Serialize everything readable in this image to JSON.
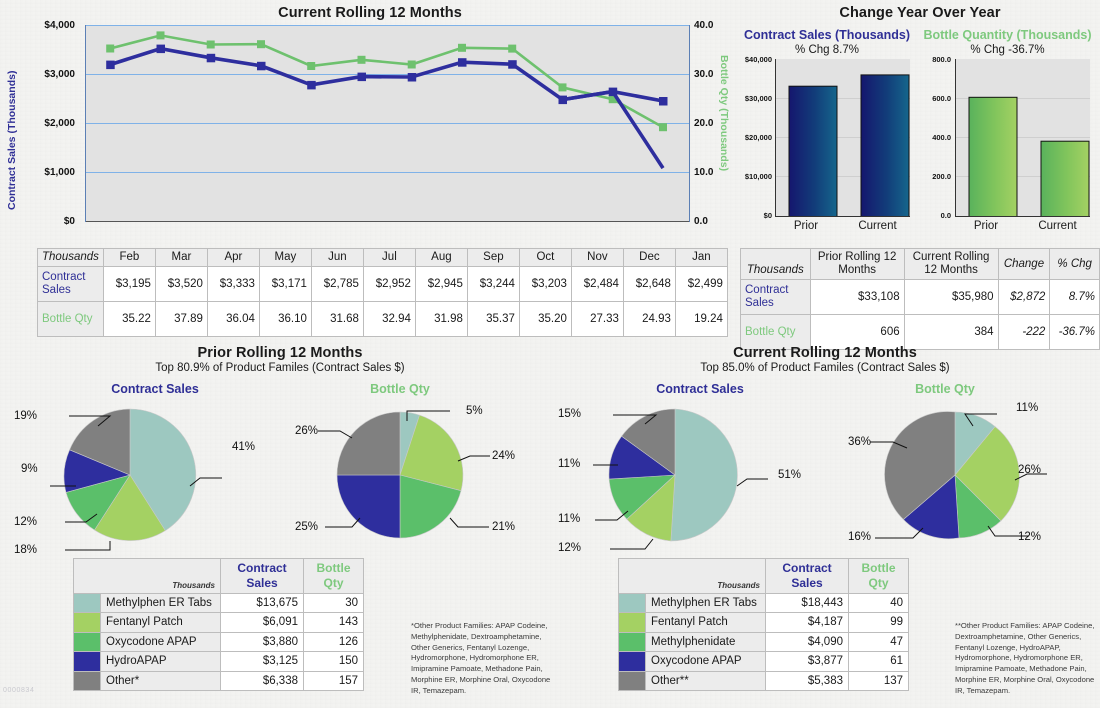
{
  "watermark": "0000834",
  "line_chart": {
    "title": "Current Rolling 12 Months",
    "y_left_label": "Contract Sales (Thousands)",
    "y_right_label": "Bottle Qty (Thousands)",
    "y_left_ticks": [
      "$4,000",
      "$3,000",
      "$2,000",
      "$1,000",
      "$0"
    ],
    "y_right_ticks": [
      "40.0",
      "30.0",
      "20.0",
      "10.0",
      "0.0"
    ]
  },
  "monthly_table": {
    "corner": "Thousands",
    "months": [
      "Feb",
      "Mar",
      "Apr",
      "May",
      "Jun",
      "Jul",
      "Aug",
      "Sep",
      "Oct",
      "Nov",
      "Dec",
      "Jan"
    ],
    "rows": [
      {
        "label": "Contract Sales",
        "values": [
          "$3,195",
          "$3,520",
          "$3,333",
          "$3,171",
          "$2,785",
          "$2,952",
          "$2,945",
          "$3,244",
          "$3,203",
          "$2,484",
          "$2,648",
          "$2,499"
        ]
      },
      {
        "label": "Bottle Qty",
        "values": [
          "35.22",
          "37.89",
          "36.04",
          "36.10",
          "31.68",
          "32.94",
          "31.98",
          "35.37",
          "35.20",
          "27.33",
          "24.93",
          "19.24"
        ]
      }
    ]
  },
  "yoy": {
    "title": "Change Year Over Year",
    "left": {
      "title": "Contract Sales (Thousands)",
      "pct_chg": "% Chg 8.7%",
      "y_ticks": [
        "$40,000",
        "$30,000",
        "$20,000",
        "$10,000",
        "$0"
      ],
      "categories": [
        "Prior",
        "Current"
      ]
    },
    "right": {
      "title": "Bottle Quantity (Thousands)",
      "pct_chg": "% Chg -36.7%",
      "y_ticks": [
        "800.0",
        "600.0",
        "400.0",
        "200.0",
        "0.0"
      ],
      "categories": [
        "Prior",
        "Current"
      ]
    }
  },
  "yoy_table": {
    "corner": "Thousands",
    "headers": [
      "Prior Rolling 12 Months",
      "Current Rolling 12 Months",
      "Change",
      "% Chg"
    ],
    "rows": [
      {
        "label": "Contract Sales",
        "prior": "$33,108",
        "current": "$35,980",
        "change": "$2,872",
        "pct": "8.7%"
      },
      {
        "label": "Bottle Qty",
        "prior": "606",
        "current": "384",
        "change": "-222",
        "pct": "-36.7%"
      }
    ]
  },
  "prior_panel": {
    "title": "Prior Rolling 12 Months",
    "subtitle": "Top 80.9% of Product Familes (Contract Sales $)",
    "pie_left_title": "Contract Sales",
    "pie_right_title": "Bottle Qty",
    "table": {
      "corner": "Thousands",
      "col_sales": "Contract Sales",
      "col_qty": "Bottle Qty",
      "rows": [
        {
          "name": "Methylphen ER Tabs",
          "sales": "$13,675",
          "qty": "30",
          "color": "#9dc8c0"
        },
        {
          "name": "Fentanyl Patch",
          "sales": "$6,091",
          "qty": "143",
          "color": "#a4d163"
        },
        {
          "name": "Oxycodone APAP",
          "sales": "$3,880",
          "qty": "126",
          "color": "#5bbf6a"
        },
        {
          "name": "HydroAPAP",
          "sales": "$3,125",
          "qty": "150",
          "color": "#2e2e9e"
        },
        {
          "name": "Other*",
          "sales": "$6,338",
          "qty": "157",
          "color": "#808080"
        }
      ]
    },
    "footnote": "*Other Product Families: APAP Codeine, Methylphenidate, Dextroamphetamine, Other Generics, Fentanyl Lozenge, Hydromorphone, Hydromorphone ER, Imipramine Pamoate, Methadone Pain, Morphine ER, Morphine Oral, Oxycodone IR, Temazepam."
  },
  "current_panel": {
    "title": "Current Rolling 12 Months",
    "subtitle": "Top 85.0% of Product Familes (Contract Sales $)",
    "pie_left_title": "Contract Sales",
    "pie_right_title": "Bottle Qty",
    "table": {
      "corner": "Thousands",
      "col_sales": "Contract Sales",
      "col_qty": "Bottle Qty",
      "rows": [
        {
          "name": "Methylphen ER Tabs",
          "sales": "$18,443",
          "qty": "40",
          "color": "#9dc8c0"
        },
        {
          "name": "Fentanyl Patch",
          "sales": "$4,187",
          "qty": "99",
          "color": "#a4d163"
        },
        {
          "name": "Methylphenidate",
          "sales": "$4,090",
          "qty": "47",
          "color": "#5bbf6a"
        },
        {
          "name": "Oxycodone APAP",
          "sales": "$3,877",
          "qty": "61",
          "color": "#2e2e9e"
        },
        {
          "name": "Other**",
          "sales": "$5,383",
          "qty": "137",
          "color": "#808080"
        }
      ]
    },
    "footnote": "**Other Product Families: APAP Codeine, Dextroamphetamine, Other Generics, Fentanyl Lozenge, HydroAPAP, Hydromorphone, Hydromorphone ER, Imipramine Pamoate, Methadone Pain, Morphine ER, Morphine Oral, Oxycodone IR, Temazepam."
  },
  "chart_data": [
    {
      "type": "line",
      "title": "Current Rolling 12 Months",
      "xlabel": "",
      "ylabel": "Contract Sales (Thousands)",
      "y2label": "Bottle Qty (Thousands)",
      "categories": [
        "Feb",
        "Mar",
        "Apr",
        "May",
        "Jun",
        "Jul",
        "Aug",
        "Sep",
        "Oct",
        "Nov",
        "Dec",
        "Jan"
      ],
      "ylim": [
        0,
        4000
      ],
      "y2lim": [
        0,
        40
      ],
      "grid": true,
      "legend": "none",
      "series": [
        {
          "name": "Contract Sales",
          "axis": "left",
          "color": "#2e2e9e",
          "values": [
            3195,
            3520,
            3333,
            3171,
            2785,
            2952,
            2945,
            3244,
            3203,
            2484,
            2648,
            2499
          ]
        },
        {
          "name": "Bottle Qty",
          "axis": "right",
          "color": "#6ec16e",
          "values": [
            35.22,
            37.89,
            36.04,
            36.1,
            31.68,
            32.94,
            31.98,
            35.37,
            35.2,
            27.33,
            24.93,
            19.24
          ]
        }
      ]
    },
    {
      "type": "bar",
      "title": "Contract Sales (Thousands)",
      "subtitle": "% Chg 8.7%",
      "categories": [
        "Prior",
        "Current"
      ],
      "values": [
        33108,
        35980
      ],
      "ylabel": "",
      "ylim": [
        0,
        40000
      ],
      "color": "#10306e"
    },
    {
      "type": "bar",
      "title": "Bottle Quantity (Thousands)",
      "subtitle": "% Chg -36.7%",
      "categories": [
        "Prior",
        "Current"
      ],
      "values": [
        606,
        384
      ],
      "ylabel": "",
      "ylim": [
        0,
        800
      ],
      "color": "#6fbe5e"
    },
    {
      "type": "pie",
      "title": "Prior Rolling 12 Months - Contract Sales",
      "labels": [
        "Methylphen ER Tabs",
        "Fentanyl Patch",
        "Oxycodone APAP",
        "HydroAPAP",
        "Other*"
      ],
      "values": [
        13675,
        6091,
        3880,
        3125,
        6338
      ],
      "percent_labels": [
        "41%",
        "18%",
        "12%",
        "9%",
        "19%"
      ],
      "colors": [
        "#9dc8c0",
        "#a4d163",
        "#5bbf6a",
        "#2e2e9e",
        "#808080"
      ]
    },
    {
      "type": "pie",
      "title": "Prior Rolling 12 Months - Bottle Qty",
      "labels": [
        "Methylphen ER Tabs",
        "Fentanyl Patch",
        "Oxycodone APAP",
        "HydroAPAP",
        "Other*"
      ],
      "values": [
        30,
        143,
        126,
        150,
        157
      ],
      "percent_labels": [
        "5%",
        "24%",
        "21%",
        "25%",
        "26%"
      ],
      "colors": [
        "#9dc8c0",
        "#a4d163",
        "#5bbf6a",
        "#2e2e9e",
        "#808080"
      ]
    },
    {
      "type": "pie",
      "title": "Current Rolling 12 Months - Contract Sales",
      "labels": [
        "Methylphen ER Tabs",
        "Fentanyl Patch",
        "Methylphenidate",
        "Oxycodone APAP",
        "Other**"
      ],
      "values": [
        18443,
        4187,
        4090,
        3877,
        5383
      ],
      "percent_labels": [
        "51%",
        "12%",
        "11%",
        "11%",
        "15%"
      ],
      "colors": [
        "#9dc8c0",
        "#a4d163",
        "#5bbf6a",
        "#2e2e9e",
        "#808080"
      ]
    },
    {
      "type": "pie",
      "title": "Current Rolling 12 Months - Bottle Qty",
      "labels": [
        "Methylphen ER Tabs",
        "Fentanyl Patch",
        "Methylphenidate",
        "Oxycodone APAP",
        "Other**"
      ],
      "values": [
        40,
        99,
        47,
        61,
        137
      ],
      "percent_labels": [
        "11%",
        "26%",
        "12%",
        "16%",
        "36%"
      ],
      "colors": [
        "#9dc8c0",
        "#a4d163",
        "#5bbf6a",
        "#2e2e9e",
        "#808080"
      ]
    }
  ]
}
